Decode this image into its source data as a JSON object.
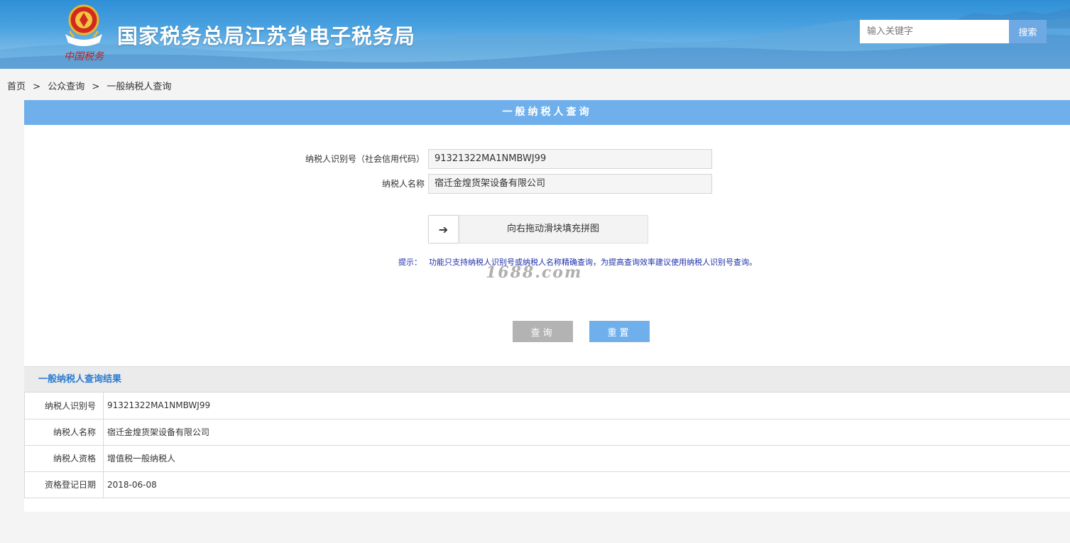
{
  "header": {
    "site_title": "国家税务总局江苏省电子税务局",
    "emblem_text": "中国税务",
    "search_placeholder": "输入关键字",
    "search_button": "搜索"
  },
  "breadcrumb": [
    "首页",
    "公众查询",
    "一般纳税人查询"
  ],
  "breadcrumb_sep": ">",
  "panel": {
    "title": "一般纳税人查询"
  },
  "form": {
    "taxpayer_id_label": "纳税人识别号（社会信用代码）",
    "taxpayer_id_value": "91321322MA1NMBWJ99",
    "taxpayer_name_label": "纳税人名称",
    "taxpayer_name_value": "宿迁金煌货架设备有限公司",
    "slider_arrow": "➔",
    "slider_text": "向右拖动滑块填充拼图",
    "hint_label": "提示：",
    "hint_text": "功能只支持纳税人识别号或纳税人名称精确查询，为提高查询效率建议使用纳税人识别号查询。",
    "watermark": "1688.com",
    "query_button": "查询",
    "reset_button": "重置"
  },
  "results": {
    "title": "一般纳税人查询结果",
    "rows": [
      {
        "key": "纳税人识别号",
        "value": "91321322MA1NMBWJ99"
      },
      {
        "key": "纳税人名称",
        "value": "宿迁金煌货架设备有限公司"
      },
      {
        "key": "纳税人资格",
        "value": "增值税一般纳税人"
      },
      {
        "key": "资格登记日期",
        "value": "2018-06-08"
      }
    ]
  },
  "colors": {
    "header_blue": "#2f8fd6",
    "panel_head": "#6fb0ec",
    "result_title": "#2b7bd0",
    "hint": "#1d2fa8"
  }
}
